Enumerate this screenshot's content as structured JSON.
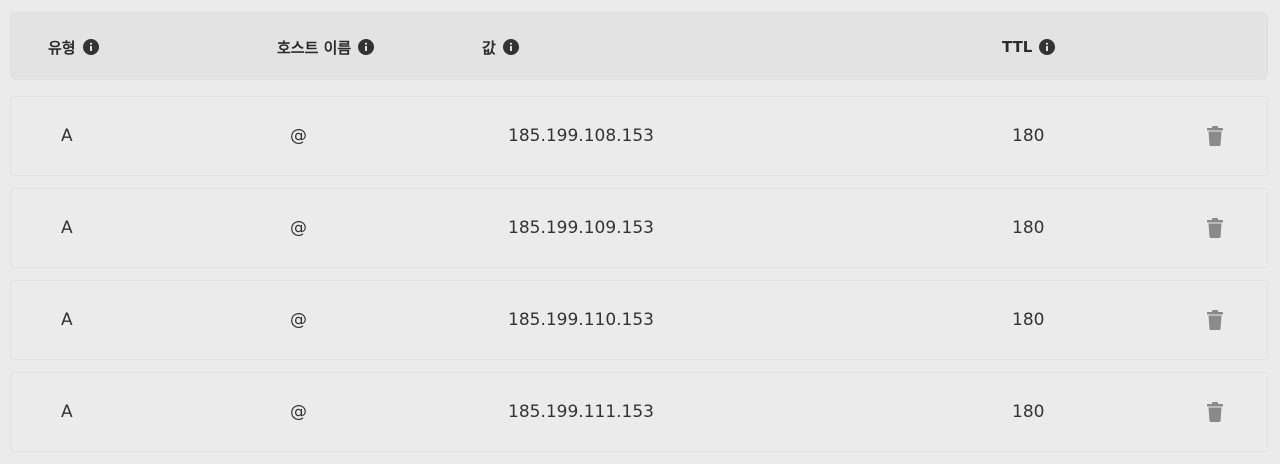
{
  "colors": {
    "background": "#ebebeb",
    "header_background": "#e3e3e4",
    "icon": "#333333",
    "delete_icon": "#8a8a8a"
  },
  "table": {
    "headers": [
      {
        "label": "유형",
        "icon": "info-icon"
      },
      {
        "label": "호스트 이름",
        "icon": "info-icon"
      },
      {
        "label": "값",
        "icon": "info-icon"
      },
      {
        "label": "TTL",
        "icon": "info-icon"
      }
    ],
    "rows": [
      {
        "type": "A",
        "host": "@",
        "value": "185.199.108.153",
        "ttl": "180",
        "action_icon": "trash-icon"
      },
      {
        "type": "A",
        "host": "@",
        "value": "185.199.109.153",
        "ttl": "180",
        "action_icon": "trash-icon"
      },
      {
        "type": "A",
        "host": "@",
        "value": "185.199.110.153",
        "ttl": "180",
        "action_icon": "trash-icon"
      },
      {
        "type": "A",
        "host": "@",
        "value": "185.199.111.153",
        "ttl": "180",
        "action_icon": "trash-icon"
      }
    ]
  }
}
